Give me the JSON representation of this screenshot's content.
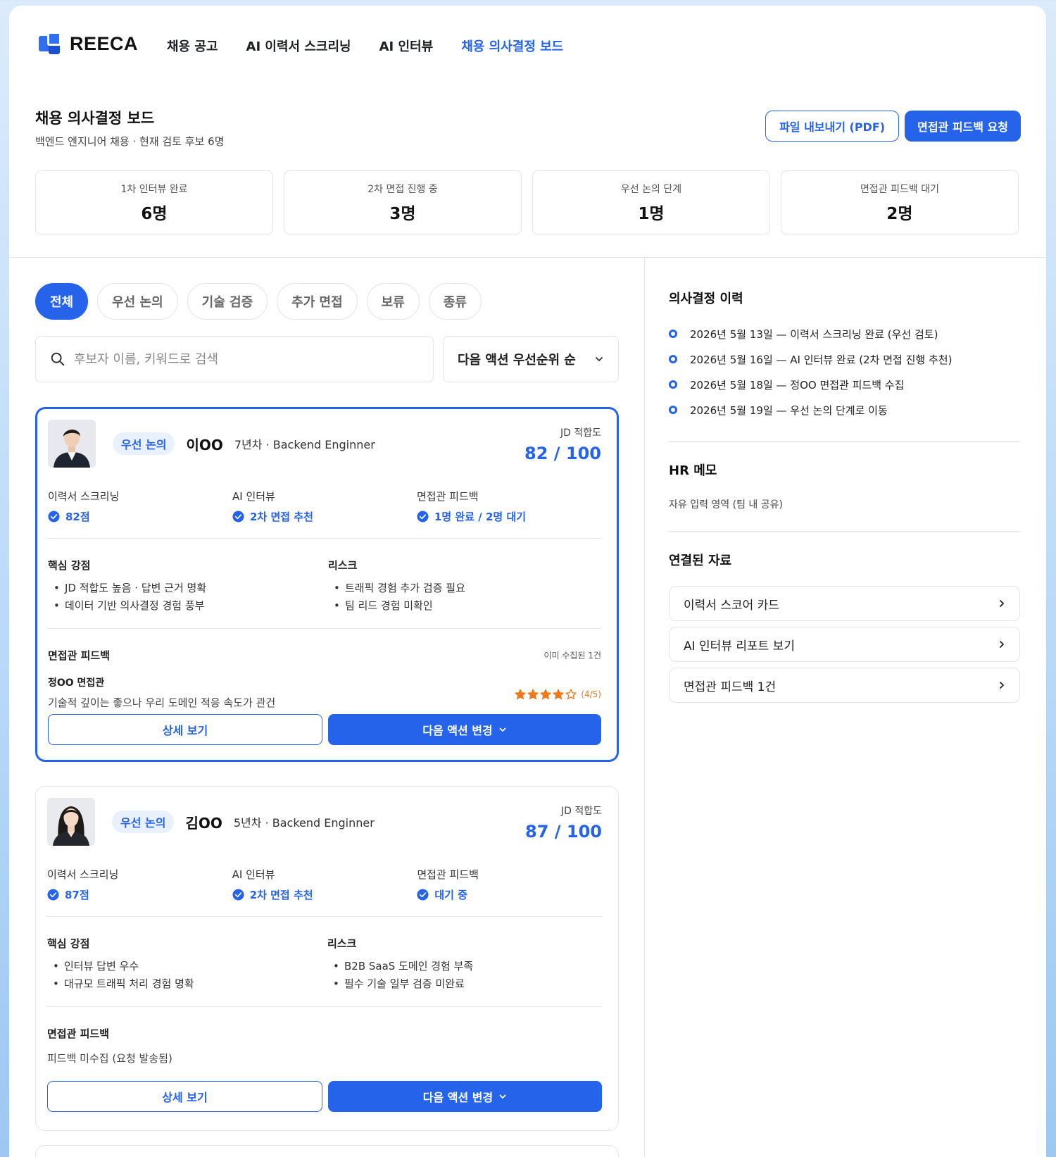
{
  "brand": {
    "name": "REECA"
  },
  "nav": [
    {
      "label": "채용 공고"
    },
    {
      "label": "AI 이력서 스크리닝"
    },
    {
      "label": "AI 인터뷰"
    },
    {
      "label": "채용 의사결정 보드"
    }
  ],
  "page": {
    "title": "채용 의사결정 보드",
    "subtitle": "백엔드 엔지니어 채용 · 현재 검토 후보 6명",
    "export_label": "파일 내보내기 (PDF)",
    "request_label": "면접관 피드백 요청"
  },
  "stats": [
    {
      "label": "1차 인터뷰 완료",
      "value": "6명"
    },
    {
      "label": "2차 면접 진행 중",
      "value": "3명"
    },
    {
      "label": "우선 논의 단계",
      "value": "1명"
    },
    {
      "label": "면접관 피드백 대기",
      "value": "2명"
    }
  ],
  "filters": [
    {
      "label": "전체"
    },
    {
      "label": "우선 논의"
    },
    {
      "label": "기술 검증"
    },
    {
      "label": "추가 면접"
    },
    {
      "label": "보류"
    },
    {
      "label": "종류"
    }
  ],
  "search": {
    "placeholder": "후보자 이름, 키워드로 검색"
  },
  "sort": {
    "label": "다음 액션 우선순위 순"
  },
  "candidates": [
    {
      "badge": "우선 논의",
      "name": "이OO",
      "meta": "7년차 · Backend Enginner",
      "jd_label": "JD 적합도",
      "jd_score": "82 / 100",
      "metrics": [
        {
          "label": "이력서 스크리닝",
          "value": "82점"
        },
        {
          "label": "AI 인터뷰",
          "value": "2차 면접 추천"
        },
        {
          "label": "면접관 피드백",
          "value": "1명 완료 / 2명 대기"
        }
      ],
      "strengths_title": "핵심 강점",
      "strengths": [
        "JD 적합도 높음 · 답변 근거 명확",
        "데이터 기반 의사결정 경험 풍부"
      ],
      "risks_title": "리스크",
      "risks": [
        "트래픽 경험 추가 검증 필요",
        "팀 리드 경험 미확인"
      ],
      "feedback_title": "면접관 피드백",
      "feedback_count": "이미 수집된 1건",
      "feedback_author": "정OO 면접관",
      "feedback_text": "기술적 깊이는 좋으나 우리 도메인 적응 속도가 관건",
      "rating": 4,
      "rating_label": "(4/5)",
      "detail_label": "상세 보기",
      "next_label": "다음 액션 변경"
    },
    {
      "badge": "우선 논의",
      "name": "김OO",
      "meta": "5년차 · Backend Enginner",
      "jd_label": "JD 적합도",
      "jd_score": "87 / 100",
      "metrics": [
        {
          "label": "이력서 스크리닝",
          "value": "87점"
        },
        {
          "label": "AI 인터뷰",
          "value": "2차 면접 추천"
        },
        {
          "label": "면접관 피드백",
          "value": "대기 중"
        }
      ],
      "strengths_title": "핵심 강점",
      "strengths": [
        "인터뷰 답변 우수",
        "대규모 트래픽 처리 경험 명확"
      ],
      "risks_title": "리스크",
      "risks": [
        "B2B SaaS 도메인 경험 부족",
        "필수 기술 일부 검증 미완료"
      ],
      "feedback_title": "면접관 피드백",
      "feedback_text": "피드백 미수집 (요청 발송됨)",
      "detail_label": "상세 보기",
      "next_label": "다음 액션 변경"
    }
  ],
  "history": {
    "title": "의사결정 이력",
    "items": [
      "2026년 5월 13일 — 이력서 스크리닝 완료 (우선 검토)",
      "2026년 5월 16일 — AI 인터뷰 완료 (2차 면접 진행 추천)",
      "2026년 5월 18일 — 정OO 면접관 피드백 수집",
      "2026년 5월 19일 — 우선 논의 단계로 이동"
    ]
  },
  "memo": {
    "title": "HR 메모",
    "placeholder": "자유 입력 영역 (팀 내 공유)"
  },
  "links": {
    "title": "연결된 자료",
    "items": [
      "이력서 스코어 카드",
      "AI 인터뷰 리포트 보기",
      "면접관 피드백 1건"
    ]
  },
  "colors": {
    "accent": "#2563eb",
    "star": "#f07a1a"
  }
}
